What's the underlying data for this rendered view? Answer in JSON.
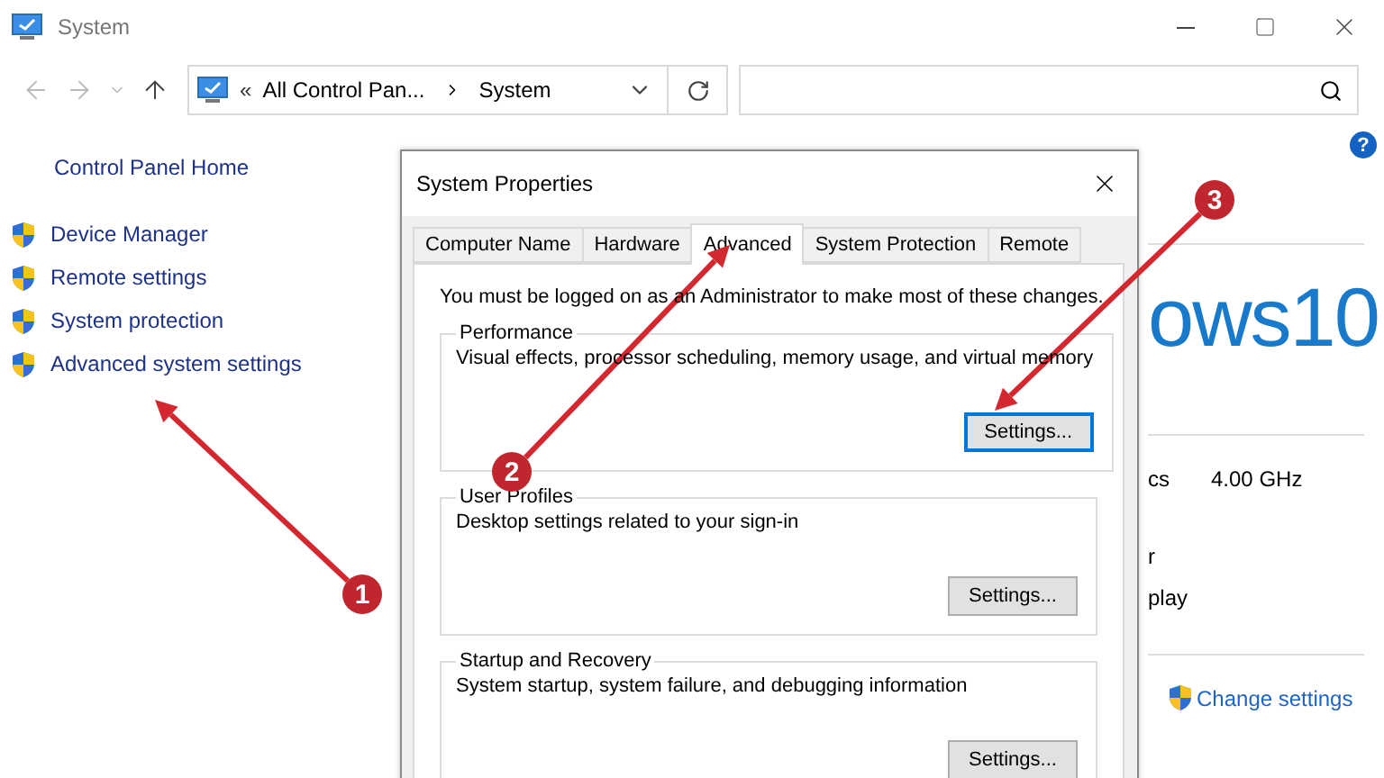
{
  "window": {
    "title": "System"
  },
  "address": {
    "overflow": "«",
    "crumbs": [
      "All Control Pan...",
      "System"
    ]
  },
  "help": "?",
  "sidebar": {
    "home": "Control Panel Home",
    "items": [
      {
        "label": "Device Manager"
      },
      {
        "label": "Remote settings"
      },
      {
        "label": "System protection"
      },
      {
        "label": "Advanced system settings"
      }
    ]
  },
  "background_panel": {
    "heading": "ows10",
    "rows": [
      {
        "label": "cs",
        "value": "4.00 GHz"
      },
      {
        "label": "r"
      },
      {
        "label": "play"
      }
    ],
    "change_settings": "Change settings"
  },
  "dialog": {
    "title": "System Properties",
    "tabs": [
      {
        "label": "Computer Name",
        "selected": false
      },
      {
        "label": "Hardware",
        "selected": false
      },
      {
        "label": "Advanced",
        "selected": true
      },
      {
        "label": "System Protection",
        "selected": false
      },
      {
        "label": "Remote",
        "selected": false
      }
    ],
    "notice": "You must be logged on as an Administrator to make most of these changes.",
    "groups": [
      {
        "title": "Performance",
        "description": "Visual effects, processor scheduling, memory usage, and virtual memory",
        "button": "Settings...",
        "focused": true
      },
      {
        "title": "User Profiles",
        "description": "Desktop settings related to your sign-in",
        "button": "Settings...",
        "focused": false
      },
      {
        "title": "Startup and Recovery",
        "description": "System startup, system failure, and debugging information",
        "button": "Settings...",
        "focused": false
      }
    ]
  },
  "annotations": [
    {
      "number": "1"
    },
    {
      "number": "2"
    },
    {
      "number": "3"
    }
  ]
}
